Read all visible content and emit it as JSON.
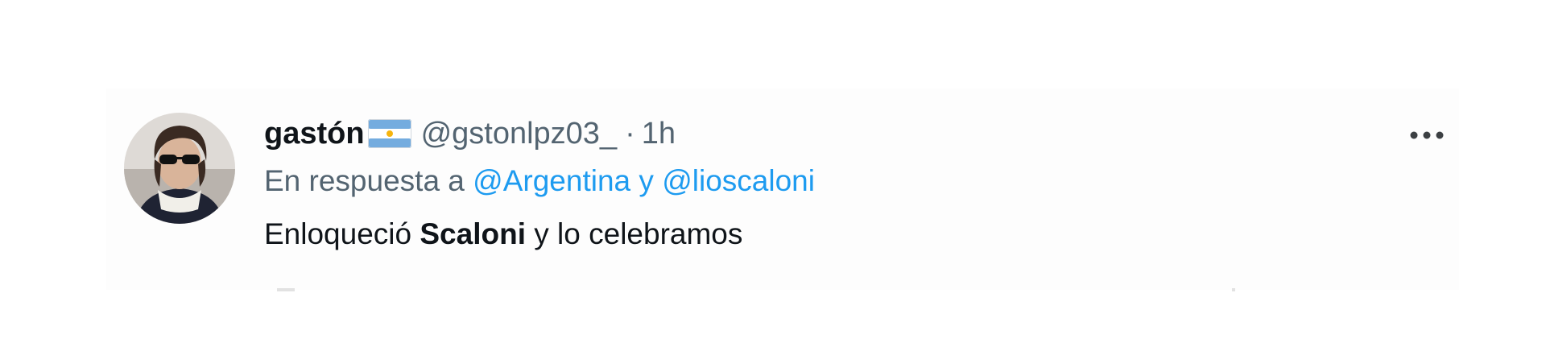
{
  "tweet": {
    "display_name": "gastón",
    "handle": "@gstonlpz03_",
    "separator": "·",
    "timestamp": "1h",
    "reply_prefix": "En respuesta a",
    "reply_mention_1": "@Argentina",
    "reply_conjunction": "y",
    "reply_mention_2": "@lioscaloni",
    "text_part_1": "Enloqueció",
    "text_bold": "Scaloni",
    "text_part_2": "y lo celebramos"
  },
  "icons": {
    "flag": "argentina-flag-icon",
    "more": "more-horizontal-icon"
  },
  "colors": {
    "mention": "#1d9bf0",
    "secondary_text": "#536471",
    "primary_text": "#0f1419",
    "flag_blue": "#74acdf"
  }
}
